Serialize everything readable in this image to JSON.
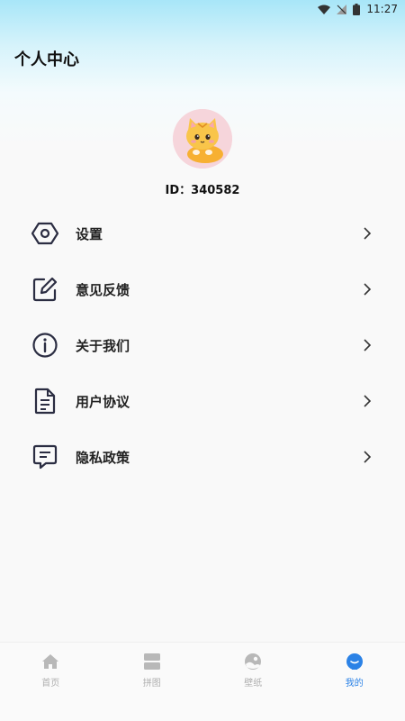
{
  "status": {
    "time": "11:27"
  },
  "header": {
    "title": "个人中心"
  },
  "profile": {
    "id_text": "ID：340582"
  },
  "menu": [
    {
      "label": "设置",
      "icon": "settings-hexagon-icon"
    },
    {
      "label": "意见反馈",
      "icon": "edit-feedback-icon"
    },
    {
      "label": "关于我们",
      "icon": "info-icon"
    },
    {
      "label": "用户协议",
      "icon": "document-icon"
    },
    {
      "label": "隐私政策",
      "icon": "privacy-chat-icon"
    }
  ],
  "tabbar": [
    {
      "label": "首页",
      "icon": "home-icon",
      "active": false
    },
    {
      "label": "拼图",
      "icon": "puzzle-icon",
      "active": false
    },
    {
      "label": "壁纸",
      "icon": "wallpaper-icon",
      "active": false
    },
    {
      "label": "我的",
      "icon": "profile-icon",
      "active": true
    }
  ],
  "colors": {
    "accent": "#2b82e6",
    "inactive": "#b0b0b0",
    "icon_dark": "#2b2d42"
  }
}
